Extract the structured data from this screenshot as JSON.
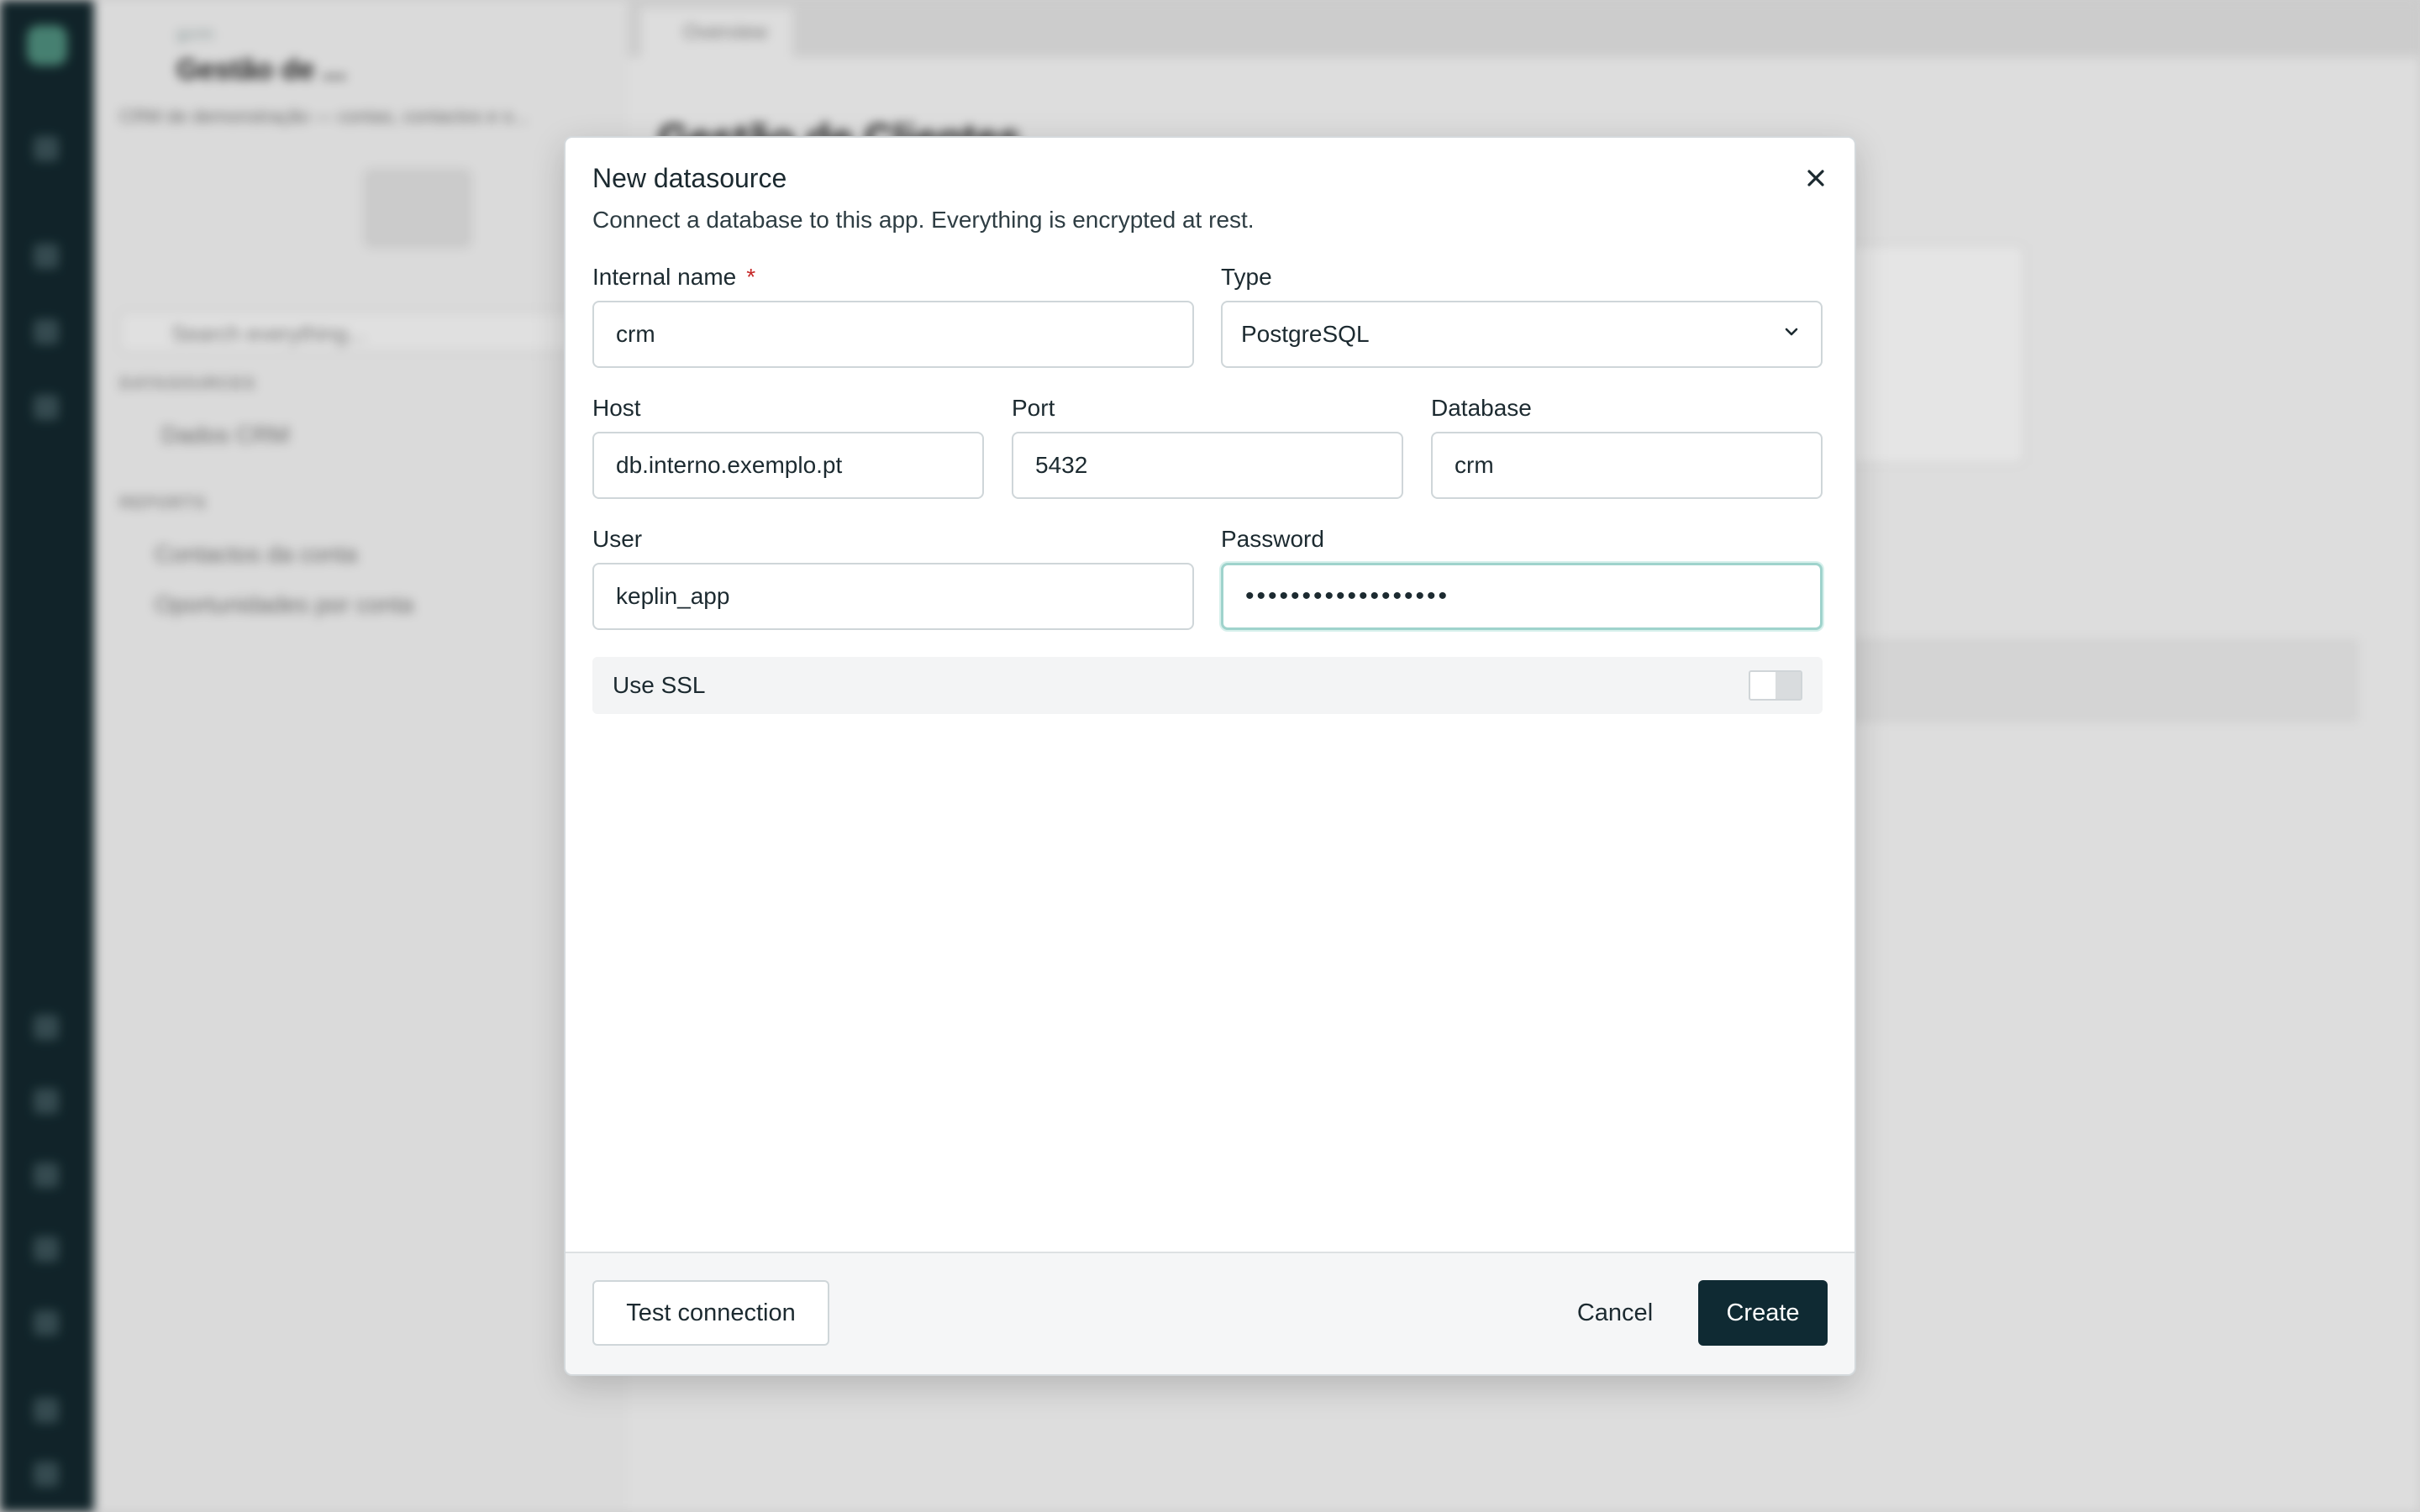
{
  "background": {
    "workspace_label": "gcrm",
    "app_name": "Gestão de ...",
    "app_description": "CRM de demonstração — contas, contactos e o...",
    "search_placeholder": "Search everything...",
    "datasources_header": "DATASOURCES",
    "datasource_item": "Dados CRM",
    "reports_header": "REPORTS",
    "report_items": [
      "Contactos da conta",
      "Oportunidades por conta"
    ],
    "open_tab": "Overview",
    "page_title": "Gestão de Clientes"
  },
  "modal": {
    "title": "New datasource",
    "subtitle": "Connect a database to this app. Everything is encrypted at rest.",
    "close_icon": "close-icon",
    "fields": {
      "internal_name": {
        "label": "Internal name",
        "required_mark": "*",
        "value": "crm"
      },
      "type": {
        "label": "Type",
        "value": "PostgreSQL",
        "icon": "chevron-down-icon"
      },
      "host": {
        "label": "Host",
        "value": "db.interno.exemplo.pt"
      },
      "port": {
        "label": "Port",
        "value": "5432"
      },
      "database": {
        "label": "Database",
        "value": "crm"
      },
      "user": {
        "label": "User",
        "value": "keplin_app"
      },
      "password": {
        "label": "Password",
        "value": "••••••••••••••••••"
      }
    },
    "ssl": {
      "label": "Use SSL",
      "enabled": false
    },
    "footer": {
      "test_label": "Test connection",
      "cancel_label": "Cancel",
      "create_label": "Create"
    }
  },
  "colors": {
    "primary_button": "#0f2a33",
    "focus_ring": "#9fd3cc",
    "required": "#c62828",
    "rail": "#13282e"
  }
}
